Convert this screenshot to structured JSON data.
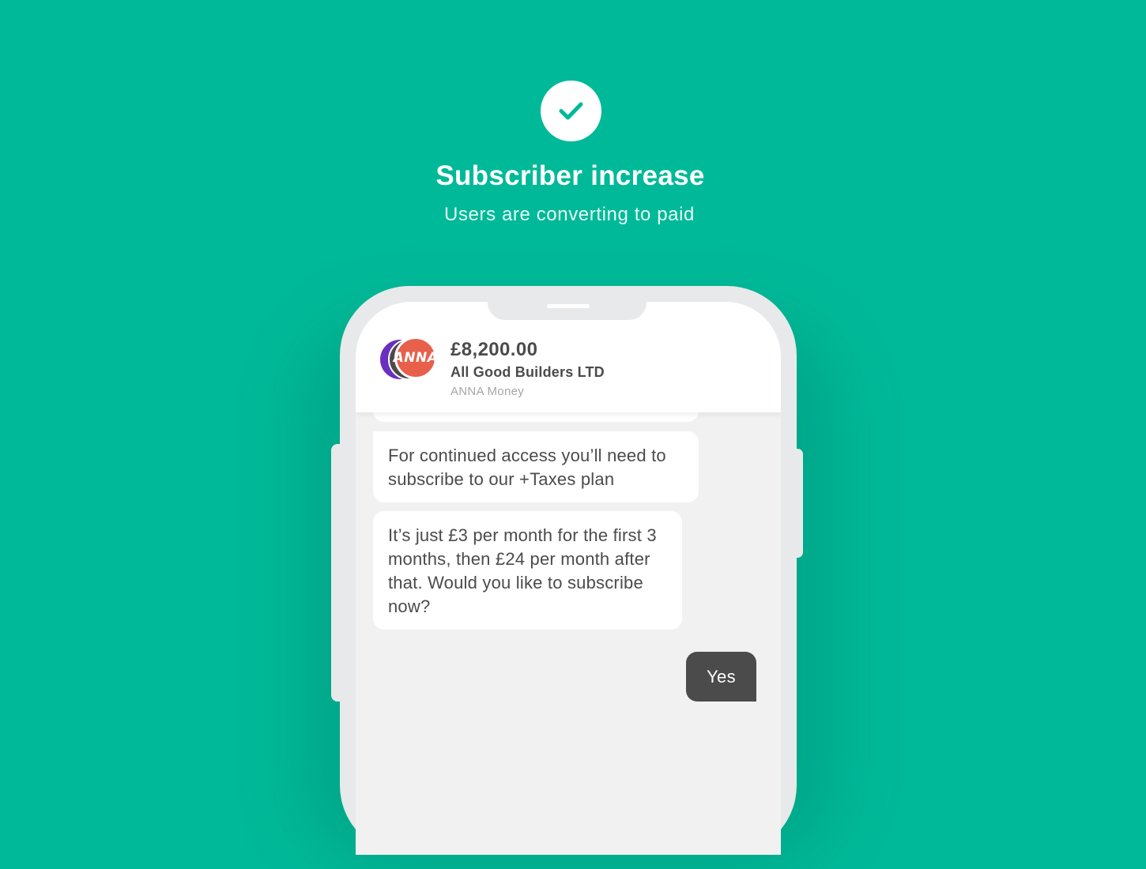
{
  "hero": {
    "icon": "check-icon",
    "title": "Subscriber increase",
    "subtitle": "Users are converting to paid"
  },
  "chat_header": {
    "amount": "£8,200.00",
    "company": "All Good Builders LTD",
    "bank": "ANNA Money",
    "avatar_label": "ANNA"
  },
  "messages": [
    {
      "from": "bot",
      "text": "For continued access you’ll need to subscribe to our +Taxes plan"
    },
    {
      "from": "bot",
      "text": "It’s just £3 per month for the first 3 months, then £24 per month after that. Would you like to subscribe now?"
    },
    {
      "from": "user",
      "text": "Yes"
    }
  ],
  "colors": {
    "background": "#00b998",
    "accent": "#00b998",
    "avatar_purple": "#6a2fbf",
    "avatar_grey": "#4b4b4b",
    "avatar_anna": "#e8604c",
    "user_bubble": "#4b4b4b"
  }
}
